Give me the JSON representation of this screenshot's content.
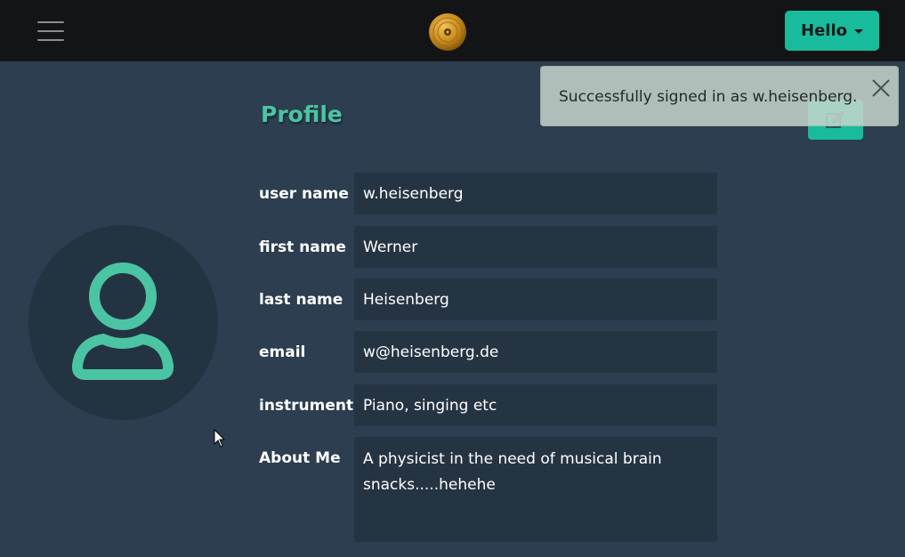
{
  "navbar": {
    "menu_icon": "hamburger-icon",
    "logo_icon": "vinyl-record-icon",
    "user_menu_label": "Hello"
  },
  "profile": {
    "title": "Profile",
    "avatar_icon": "user-icon",
    "edit_icon": "edit-icon",
    "fields": [
      {
        "label": "user name",
        "value": "w.heisenberg"
      },
      {
        "label": "first name",
        "value": "Werner"
      },
      {
        "label": "last name",
        "value": "Heisenberg"
      },
      {
        "label": "email",
        "value": "w@heisenberg.de"
      },
      {
        "label": "instruments",
        "value": "Piano, singing etc"
      }
    ],
    "about": {
      "label": "About Me",
      "value": "A physicist in the need of musical brain snacks.....hehehe"
    }
  },
  "toast": {
    "message": "Successfully signed in as w.heisenberg.",
    "close_icon": "close-icon"
  },
  "colors": {
    "background": "#2c3e50",
    "navbar": "#131416",
    "accent": "#18bc9c",
    "field": "#253443"
  }
}
